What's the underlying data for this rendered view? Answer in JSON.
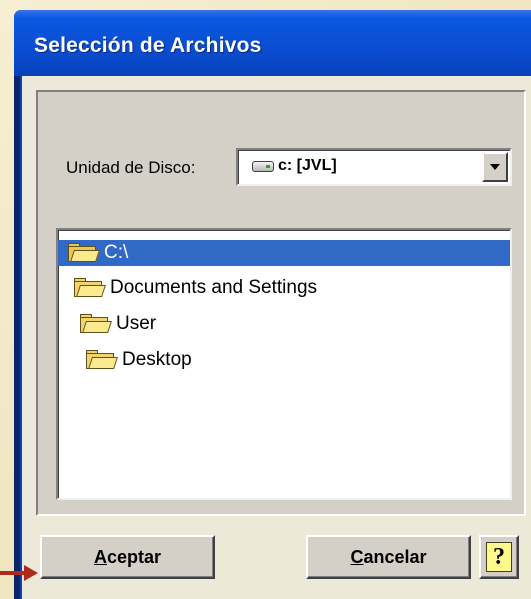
{
  "window": {
    "title": "Selección de Archivos"
  },
  "drive": {
    "label": "Unidad de Disco:",
    "value": "c: [JVL]",
    "icon": "drive-icon"
  },
  "folders": [
    {
      "name": "C:\\",
      "selected": true
    },
    {
      "name": "Documents and Settings",
      "selected": false
    },
    {
      "name": "User",
      "selected": false
    },
    {
      "name": "Desktop",
      "selected": false
    }
  ],
  "buttons": {
    "accept_mnemonic": "A",
    "accept_rest": "ceptar",
    "cancel_mnemonic": "C",
    "cancel_rest": "ancelar",
    "help_glyph": "?"
  },
  "colors": {
    "titlebar": "#0a4fd4",
    "selection": "#3169c6",
    "arrow": "#b02a1a"
  }
}
